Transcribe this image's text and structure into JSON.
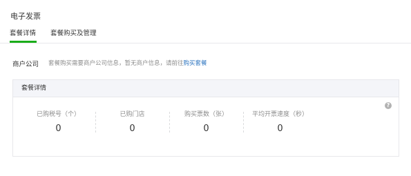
{
  "page": {
    "title": "电子发票"
  },
  "tabs": [
    {
      "label": "套餐详情",
      "active": true
    },
    {
      "label": "套餐购买及管理",
      "active": false
    }
  ],
  "merchant": {
    "label": "商户公司",
    "text": "套餐购买需要商户公司信息，暂无商户信息，请前往",
    "link": "购买套餐"
  },
  "panel": {
    "title": "套餐详情",
    "help_icon": "question-circle-icon",
    "stats": [
      {
        "label": "已购税号（个）",
        "value": "0"
      },
      {
        "label": "已购门店",
        "value": "0"
      },
      {
        "label": "购买票数（张）",
        "value": "0"
      },
      {
        "label": "平均开票速度（秒）",
        "value": "0"
      }
    ]
  },
  "colors": {
    "accent": "#1aad19",
    "link": "#2e75c0"
  }
}
